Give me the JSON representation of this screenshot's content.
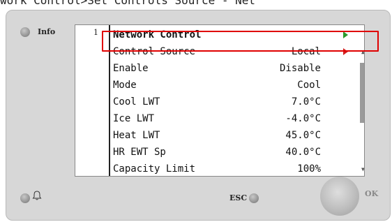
{
  "caption": "work Control>Set Controls Source - Net",
  "panel": {
    "info_label": "Info",
    "line_number": "1",
    "esc_label": "ESC",
    "ok_label": "OK"
  },
  "menu": {
    "title": "Network Control",
    "rows": [
      {
        "label": "Control Source",
        "value": "Local",
        "arrow": "red"
      },
      {
        "label": "Enable",
        "value": "Disable"
      },
      {
        "label": "Mode",
        "value": "Cool"
      },
      {
        "label": "Cool LWT",
        "value": "7.0°C"
      },
      {
        "label": "Ice LWT",
        "value": "-4.0°C"
      },
      {
        "label": "Heat LWT",
        "value": "45.0°C"
      },
      {
        "label": "HR EWT Sp",
        "value": "40.0°C"
      },
      {
        "label": "Capacity Limit",
        "value": "100%"
      }
    ]
  },
  "icons": {
    "title_arrow": "play-right-icon",
    "row_arrow": "play-right-icon",
    "bell": "bell-icon",
    "scroll_up": "triangle-up-icon",
    "scroll_down": "triangle-down-icon"
  },
  "colors": {
    "title_arrow": "#2c9a2c",
    "row_arrow": "#d42020",
    "highlight": "#e00000",
    "panel": "#d7d7d7"
  }
}
